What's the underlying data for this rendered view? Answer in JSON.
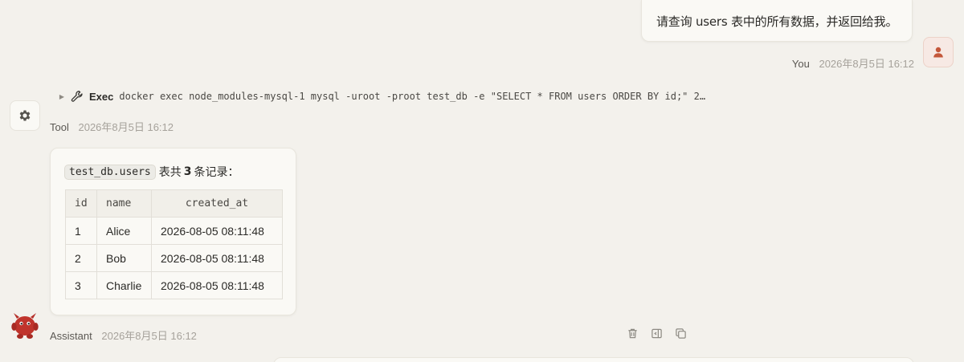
{
  "user_message": {
    "text": "请查询 users 表中的所有数据，并返回给我。",
    "author": "You",
    "time": "2026年8月5日 16:12"
  },
  "tool_call": {
    "label": "Exec",
    "command": "docker exec node_modules-mysql-1 mysql -uroot -proot test_db -e \"SELECT * FROM users ORDER BY id;\" 2…",
    "author": "Tool",
    "time": "2026年8月5日 16:12"
  },
  "assistant_message": {
    "summary_code": "test_db.users",
    "summary_prefix": "表共",
    "summary_count": "3",
    "summary_suffix": "条记录：",
    "table": {
      "headers": [
        "id",
        "name",
        "created_at"
      ],
      "rows": [
        [
          "1",
          "Alice",
          "2026-08-05 08:11:48"
        ],
        [
          "2",
          "Bob",
          "2026-08-05 08:11:48"
        ],
        [
          "3",
          "Charlie",
          "2026-08-05 08:11:48"
        ]
      ]
    },
    "author": "Assistant",
    "time": "2026年8月5日 16:12",
    "actions": [
      "trash-icon",
      "sidebar-panel-icon",
      "copy-icon"
    ]
  },
  "colors": {
    "background": "#f3f1ec",
    "card": "#faf9f5",
    "user_avatar_accent": "#c4573a",
    "assistant_avatar": "#b5302a"
  }
}
